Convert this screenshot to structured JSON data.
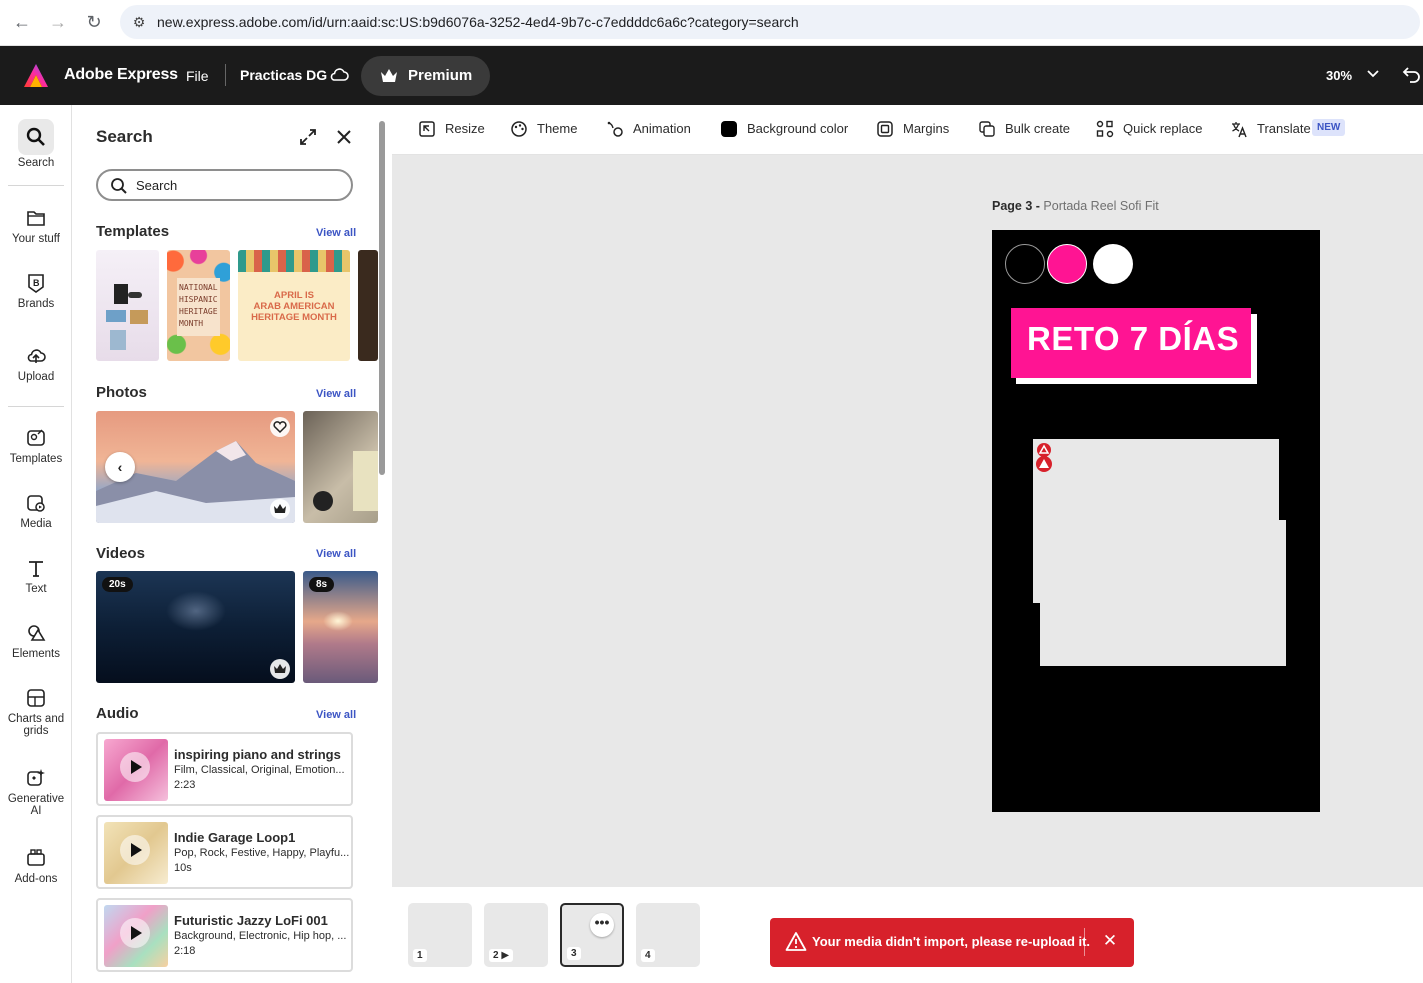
{
  "browser": {
    "url": "new.express.adobe.com/id/urn:aaid:sc:US:b9d6076a-3252-4ed4-9b7c-c7eddddc6a6c?category=search"
  },
  "header": {
    "app_name": "Adobe Express",
    "file_menu": "File",
    "doc_name": "Practicas DG",
    "premium_label": "Premium",
    "zoom": "30%"
  },
  "rail": {
    "items": [
      {
        "label": "Search",
        "icon": "search-icon"
      },
      {
        "label": "Your stuff",
        "icon": "folder-icon"
      },
      {
        "label": "Brands",
        "icon": "brand-icon"
      },
      {
        "label": "Upload",
        "icon": "upload-icon"
      },
      {
        "label": "Templates",
        "icon": "templates-icon"
      },
      {
        "label": "Media",
        "icon": "media-icon"
      },
      {
        "label": "Text",
        "icon": "text-icon"
      },
      {
        "label": "Elements",
        "icon": "elements-icon"
      },
      {
        "label": "Charts and grids",
        "icon": "charts-icon"
      },
      {
        "label": "Generative AI",
        "icon": "sparkle-icon"
      },
      {
        "label": "Add-ons",
        "icon": "addons-icon"
      }
    ]
  },
  "panel": {
    "title": "Search",
    "search_placeholder": "Search",
    "view_all": "View all",
    "sections": {
      "templates": "Templates",
      "photos": "Photos",
      "videos": "Videos",
      "audio": "Audio"
    },
    "template_texts": {
      "hispanic": "NATIONAL HISPANIC HERITAGE MONTH",
      "arab_line1": "APRIL IS",
      "arab_line2": "ARAB AMERICAN",
      "arab_line3": "HERITAGE MONTH"
    },
    "videos": [
      {
        "duration": "20s"
      },
      {
        "duration": "8s"
      }
    ],
    "audio": [
      {
        "title": "inspiring piano and strings",
        "genres": "Film, Classical, Original, Emotion...",
        "duration": "2:23"
      },
      {
        "title": "Indie Garage Loop1",
        "genres": "Pop, Rock, Festive, Happy, Playfu...",
        "duration": "10s"
      },
      {
        "title": "Futuristic Jazzy LoFi 001",
        "genres": "Background, Electronic, Hip hop, ...",
        "duration": "2:18"
      }
    ]
  },
  "toolbar": {
    "items": [
      {
        "label": "Resize",
        "icon": "resize-icon"
      },
      {
        "label": "Theme",
        "icon": "palette-icon"
      },
      {
        "label": "Animation",
        "icon": "animation-icon"
      },
      {
        "label": "Background color",
        "icon": "color-swatch-icon"
      },
      {
        "label": "Margins",
        "icon": "margins-icon"
      },
      {
        "label": "Bulk create",
        "icon": "bulk-create-icon"
      },
      {
        "label": "Quick replace",
        "icon": "quick-replace-icon"
      },
      {
        "label": "Translate",
        "icon": "translate-icon"
      }
    ],
    "new_badge": "NEW"
  },
  "canvas": {
    "page_label": "Page 3 -",
    "page_name": "Portada Reel Sofi Fit",
    "headline": "RETO 7 DÍAS",
    "colors": {
      "pink": "#ff1493",
      "black": "#000000",
      "white": "#ffffff"
    }
  },
  "pages": [
    {
      "num": "1"
    },
    {
      "num": "2"
    },
    {
      "num": "3"
    },
    {
      "num": "4"
    }
  ],
  "toast": {
    "message": "Your media didn't import, please re-upload it."
  }
}
